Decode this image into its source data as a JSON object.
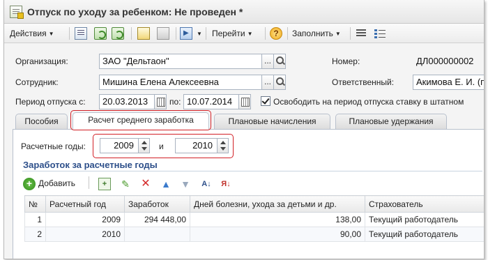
{
  "window": {
    "title": "Отпуск по уходу за ребенком: Не проведен *"
  },
  "toolbar": {
    "actions_label": "Действия",
    "goto_label": "Перейти",
    "help_symbol": "?",
    "fill_label": "Заполнить"
  },
  "form": {
    "org_label": "Организация:",
    "org_value": "ЗАО \"Дельтаон\"",
    "number_label": "Номер:",
    "number_value": "ДЛ000000002",
    "employee_label": "Сотрудник:",
    "employee_value": "Мишина Елена Алексеевна",
    "responsible_label": "Ответственный:",
    "responsible_value": "Акимова Е. И. (п",
    "period_from_label": "Период отпуска с:",
    "period_from_value": "20.03.2013",
    "period_to_label": "по:",
    "period_to_value": "10.07.2014",
    "release_checkbox_label": "Освободить на период отпуска ставку в штатном",
    "release_checked": true,
    "dots": "..."
  },
  "tabs": [
    {
      "label": "Пособия",
      "active": false
    },
    {
      "label": "Расчет среднего заработка",
      "active": true
    },
    {
      "label": "Плановые начисления",
      "active": false
    },
    {
      "label": "Плановые удержания",
      "active": false
    }
  ],
  "calc": {
    "years_label": "Расчетные годы:",
    "year1": "2009",
    "and_label": "и",
    "year2": "2010",
    "section_title": "Заработок за расчетные годы",
    "add_label": "Добавить"
  },
  "table": {
    "columns": [
      "№",
      "Расчетный год",
      "Заработок",
      "Дней болезни, ухода за детьми и др.",
      "Страхователь"
    ],
    "rows": [
      {
        "n": "1",
        "year": "2009",
        "earnings": "294 448,00",
        "days": "138,00",
        "insurer": "Текущий работодатель"
      },
      {
        "n": "2",
        "year": "2010",
        "earnings": "",
        "days": "90,00",
        "insurer": "Текущий работодатель"
      }
    ]
  },
  "colors": {
    "highlight": "#d21f25",
    "section_title": "#2d4f8a"
  }
}
